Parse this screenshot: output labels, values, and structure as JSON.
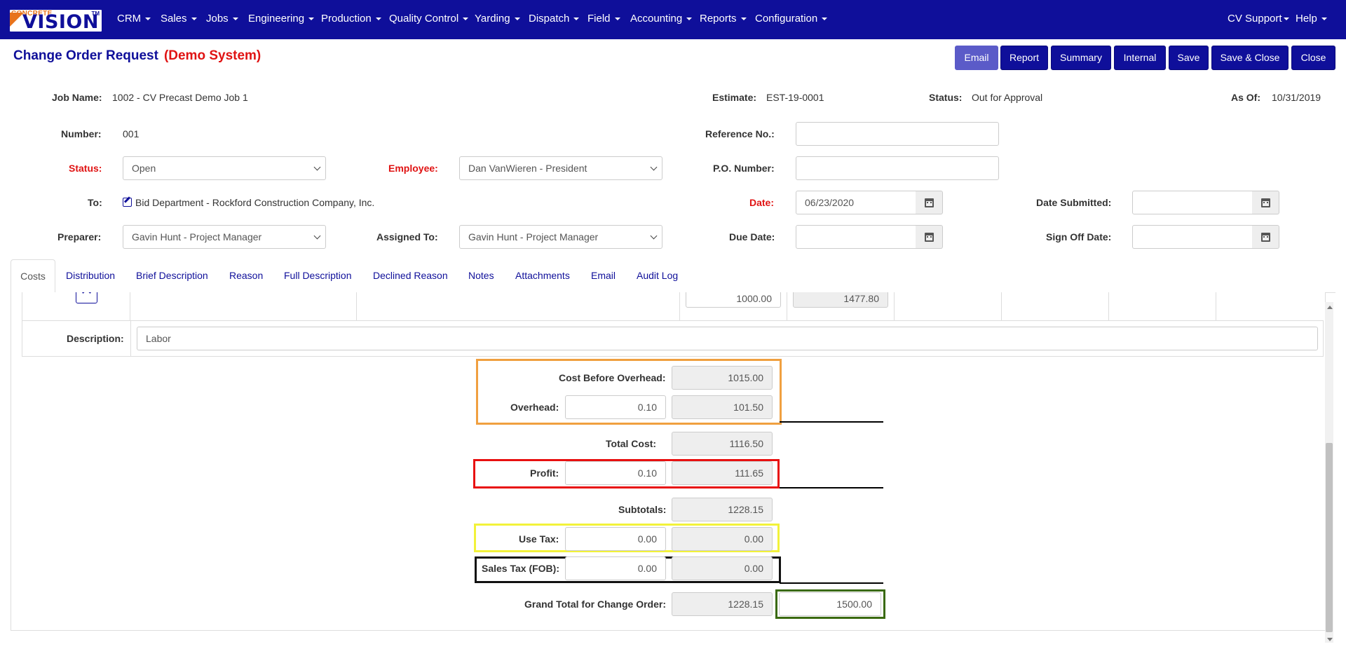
{
  "app": {
    "logo_small": "CONCRETE",
    "logo_big": "VISION",
    "logo_tm": "TM"
  },
  "nav": {
    "items": [
      "CRM",
      "Sales",
      "Jobs",
      "Engineering",
      "Production",
      "Quality Control",
      "Yarding",
      "Dispatch",
      "Field",
      "Accounting",
      "Reports",
      "Configuration"
    ],
    "right": [
      "CV Support",
      "Help"
    ]
  },
  "header": {
    "title": "Change Order Request",
    "demo": "(Demo System)",
    "buttons": [
      "Email",
      "Report",
      "Summary",
      "Internal",
      "Save",
      "Save & Close",
      "Close"
    ]
  },
  "info": {
    "job_name_label": "Job Name:",
    "job_name": "1002 - CV Precast Demo Job 1",
    "estimate_label": "Estimate:",
    "estimate": "EST-19-0001",
    "status_label": "Status:",
    "status": "Out for Approval",
    "as_of_label": "As Of:",
    "as_of": "10/31/2019"
  },
  "form": {
    "number_label": "Number:",
    "number": "001",
    "reference_label": "Reference No.:",
    "reference": "",
    "status_label": "Status:",
    "status": "Open",
    "employee_label": "Employee:",
    "employee": "Dan VanWieren - President",
    "po_label": "P.O. Number:",
    "po": "",
    "to_label": "To:",
    "to": "Bid Department - Rockford Construction Company, Inc.",
    "date_label": "Date:",
    "date": "06/23/2020",
    "date_submitted_label": "Date Submitted:",
    "date_submitted": "",
    "preparer_label": "Preparer:",
    "preparer": "Gavin Hunt - Project Manager",
    "assigned_label": "Assigned To:",
    "assigned": "Gavin Hunt - Project Manager",
    "due_date_label": "Due Date:",
    "due_date": "",
    "sign_off_label": "Sign Off Date:",
    "sign_off": ""
  },
  "tabs": [
    "Costs",
    "Distribution",
    "Brief Description",
    "Reason",
    "Full Description",
    "Declined Reason",
    "Notes",
    "Attachments",
    "Email",
    "Audit Log"
  ],
  "costs": {
    "row_partial_a": "1000.00",
    "row_partial_b": "1477.80",
    "description_label": "Description:",
    "description": "Labor",
    "cost_before_overhead_label": "Cost Before Overhead:",
    "cost_before_overhead": "1015.00",
    "overhead_label": "Overhead:",
    "overhead_rate": "0.10",
    "overhead_amount": "101.50",
    "total_cost_label": "Total Cost:",
    "total_cost": "1116.50",
    "profit_label": "Profit:",
    "profit_rate": "0.10",
    "profit_amount": "111.65",
    "subtotals_label": "Subtotals:",
    "subtotals": "1228.15",
    "use_tax_label": "Use Tax:",
    "use_tax_rate": "0.00",
    "use_tax_amount": "0.00",
    "sales_tax_label": "Sales Tax (FOB):",
    "sales_tax_rate": "0.00",
    "sales_tax_amount": "0.00",
    "grand_total_label": "Grand Total for Change Order:",
    "grand_total": "1228.15",
    "grand_total_override": "1500.00"
  },
  "highlight_colors": {
    "overhead": "#f0a040",
    "profit": "#e81010",
    "use_tax": "#f2f23a",
    "sales_tax": "#111111",
    "grand_total": "#3a6a10"
  }
}
